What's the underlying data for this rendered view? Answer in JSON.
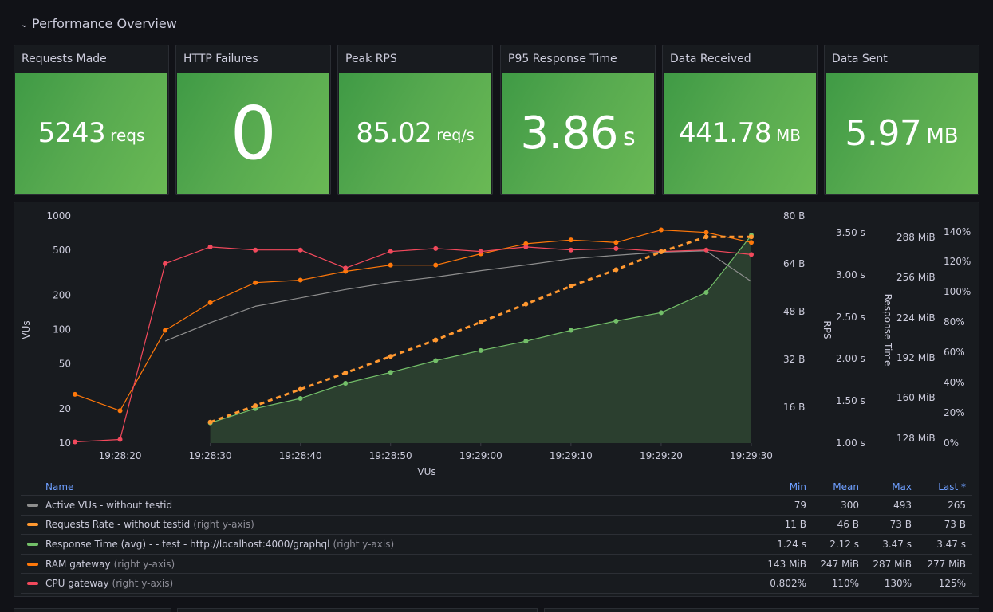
{
  "row": {
    "title": "Performance Overview",
    "collapse_icon": "chevron-down-icon"
  },
  "stats": [
    {
      "title": "Requests Made",
      "value": "5243",
      "unit": "reqs"
    },
    {
      "title": "HTTP Failures",
      "value": "0",
      "unit": ""
    },
    {
      "title": "Peak RPS",
      "value": "85.02",
      "unit": "req/s"
    },
    {
      "title": "P95 Response Time",
      "value": "3.86",
      "unit": "s"
    },
    {
      "title": "Data Received",
      "value": "441.78",
      "unit": "MB"
    },
    {
      "title": "Data Sent",
      "value": "5.97",
      "unit": "MB"
    }
  ],
  "stat_color": "#56a94f",
  "chart_data": {
    "type": "line",
    "title": "",
    "xlabel": "VUs",
    "x": [
      "19:28:15",
      "19:28:20",
      "19:28:25",
      "19:28:30",
      "19:28:35",
      "19:28:40",
      "19:28:45",
      "19:28:50",
      "19:28:55",
      "19:29:00",
      "19:29:05",
      "19:29:10",
      "19:29:15",
      "19:29:20",
      "19:29:25",
      "19:29:30"
    ],
    "x_ticks": [
      "19:28:20",
      "19:28:30",
      "19:28:40",
      "19:28:50",
      "19:29:00",
      "19:29:10",
      "19:29:20",
      "19:29:30"
    ],
    "axes": [
      {
        "id": "vus",
        "label": "VUs",
        "side": "left",
        "scale": "log",
        "ticks": [
          "1000",
          "500",
          "200",
          "100",
          "50",
          "20",
          "10"
        ],
        "range": [
          10,
          1000
        ]
      },
      {
        "id": "rps",
        "label": "RPS",
        "side": "right",
        "scale": "linear",
        "ticks": [
          "80 B",
          "64 B",
          "48 B",
          "32 B",
          "16 B"
        ],
        "range": [
          0,
          85
        ]
      },
      {
        "id": "resp",
        "label": "Response Time",
        "side": "right",
        "scale": "linear",
        "ticks": [
          "3.50 s",
          "3.00 s",
          "2.50 s",
          "2.00 s",
          "1.50 s",
          "1.00 s"
        ],
        "range": [
          1.0,
          3.5
        ]
      },
      {
        "id": "ram",
        "label": "",
        "side": "right",
        "scale": "linear",
        "ticks": [
          "288 MiB",
          "256 MiB",
          "224 MiB",
          "192 MiB",
          "160 MiB",
          "128 MiB"
        ],
        "range": [
          124,
          288
        ]
      },
      {
        "id": "cpu",
        "label": "",
        "side": "right",
        "scale": "linear",
        "ticks": [
          "140%",
          "120%",
          "100%",
          "80%",
          "60%",
          "40%",
          "20%",
          "0%"
        ],
        "range": [
          0,
          140
        ]
      }
    ],
    "series": [
      {
        "name": "Active VUs - without testid",
        "axis": "vus",
        "color": "#8e8e8e",
        "style": "line",
        "points": false,
        "values": [
          null,
          null,
          79,
          115,
          160,
          190,
          225,
          260,
          290,
          330,
          370,
          420,
          450,
          480,
          493,
          265
        ]
      },
      {
        "name": "Requests Rate - without testid",
        "axis": "rps",
        "color": "#ff9830",
        "style": "dashed",
        "points": true,
        "values": [
          null,
          null,
          null,
          11,
          16.5,
          22,
          27.5,
          33,
          38.5,
          44.5,
          50.5,
          56.5,
          62,
          68,
          73,
          73
        ]
      },
      {
        "name": "Response Time (avg) - - test - http://localhost:4000/graphql",
        "axis": "resp",
        "color": "#73bf69",
        "style": "area",
        "points": true,
        "values": [
          null,
          null,
          null,
          1.24,
          1.41,
          1.53,
          1.71,
          1.84,
          1.98,
          2.1,
          2.21,
          2.34,
          2.45,
          2.55,
          2.79,
          3.47
        ]
      },
      {
        "name": "RAM gateway",
        "axis": "ram",
        "color": "#ff780a",
        "style": "line",
        "points": true,
        "values": [
          163,
          150,
          214,
          236,
          252,
          254,
          261,
          266,
          266,
          275,
          283,
          286,
          284,
          294,
          292,
          284
        ]
      },
      {
        "name": "CPU gateway",
        "axis": "cpu",
        "color": "#f2495c",
        "style": "line",
        "points": true,
        "values": [
          0.8,
          2.4,
          119,
          130,
          128,
          128,
          116,
          127,
          129,
          127,
          130,
          128,
          129,
          127,
          128,
          125
        ]
      }
    ]
  },
  "legend": {
    "headers": {
      "name": "Name",
      "min": "Min",
      "mean": "Mean",
      "max": "Max",
      "last": "Last *"
    },
    "axis_note": "(right y-axis)",
    "rows": [
      {
        "name": "Active VUs - without testid",
        "color": "#8e8e8e",
        "note": "",
        "min": "79",
        "mean": "300",
        "max": "493",
        "last": "265"
      },
      {
        "name": "Requests Rate - without testid",
        "color": "#ff9830",
        "note": "(right y-axis)",
        "min": "11 B",
        "mean": "46 B",
        "max": "73 B",
        "last": "73 B"
      },
      {
        "name": "Response Time (avg) - - test - http://localhost:4000/graphql",
        "color": "#73bf69",
        "note": "(right y-axis)",
        "min": "1.24 s",
        "mean": "2.12 s",
        "max": "3.47 s",
        "last": "3.47 s"
      },
      {
        "name": "RAM gateway",
        "color": "#ff780a",
        "note": "(right y-axis)",
        "min": "143 MiB",
        "mean": "247 MiB",
        "max": "287 MiB",
        "last": "277 MiB"
      },
      {
        "name": "CPU gateway",
        "color": "#f2495c",
        "note": "(right y-axis)",
        "min": "0.802%",
        "mean": "110%",
        "max": "130%",
        "last": "125%"
      }
    ]
  }
}
